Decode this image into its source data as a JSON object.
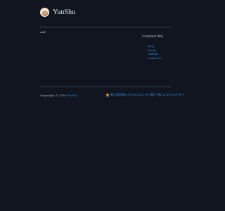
{
  "header": {
    "logo_icon": "avatar-logo-icon",
    "title": "YunShu"
  },
  "about": {
    "text": "null"
  },
  "contact": {
    "title": "Contact Me",
    "items": [
      {
        "label": "Blog"
      },
      {
        "label": "Email"
      },
      {
        "label": "GitHub"
      },
      {
        "label": "Unknown"
      }
    ]
  },
  "footer": {
    "copyright_prefix": "Copyright © 2026",
    "author": "YunShu",
    "police_icon": "police-badge-icon",
    "icp": "蜀公网安备51010602001783 蜀ICP备2023029687号-1"
  },
  "colors": {
    "background": "#101520",
    "link": "#2f8dde",
    "divider": "#3c434f"
  }
}
